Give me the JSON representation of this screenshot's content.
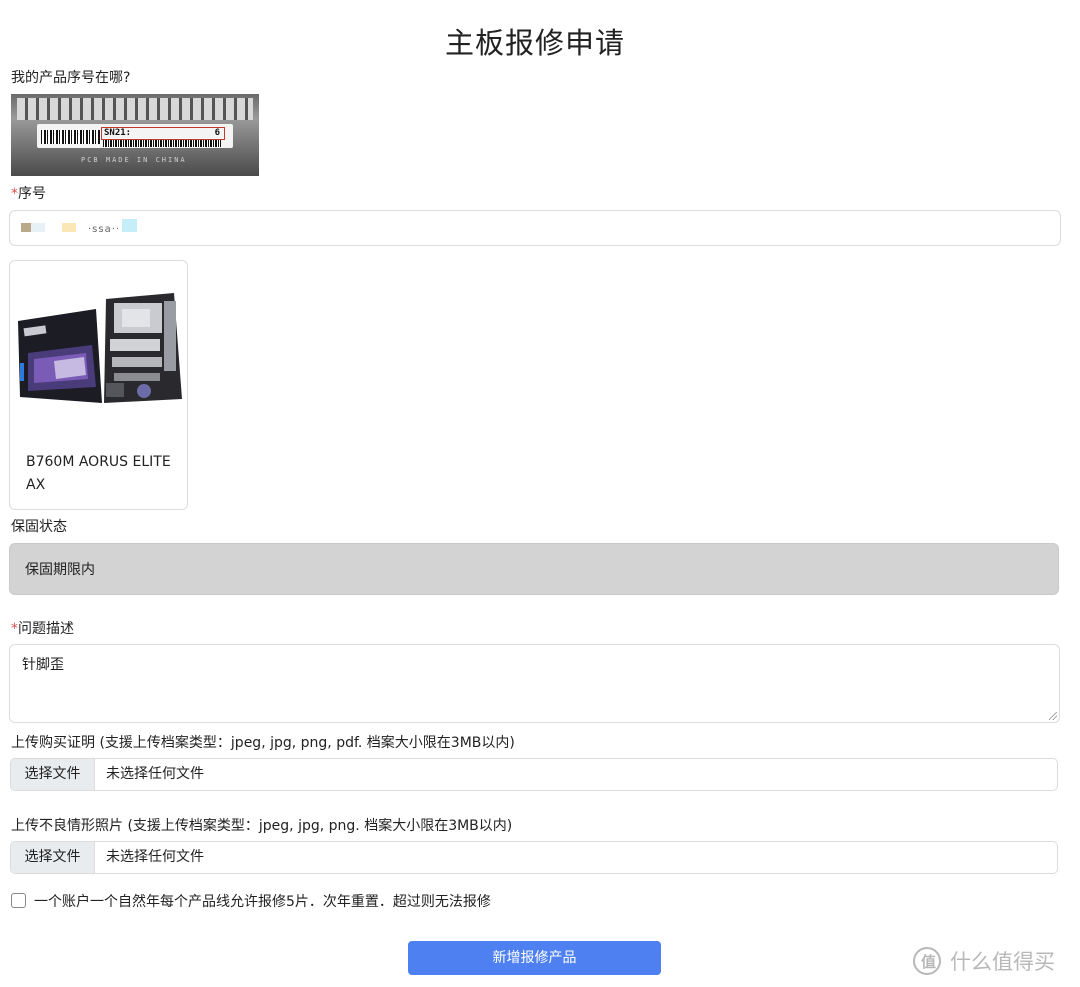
{
  "page": {
    "title": "主板报修申请"
  },
  "serial_help": {
    "label": "我的产品序号在哪?",
    "photo_text": "SN21:",
    "photo_digit": "6",
    "photo_pcb": "PCB MADE IN CHINA"
  },
  "serial": {
    "required_mark": "*",
    "label": "序号",
    "value_visible": "·ssa··"
  },
  "product": {
    "name": "B760M AORUS ELITE AX"
  },
  "warranty": {
    "label": "保固状态",
    "value": "保固期限内"
  },
  "problem": {
    "required_mark": "*",
    "label": "问题描述",
    "value": "针脚歪"
  },
  "proof_upload": {
    "label": "上传购买证明 (支援上传档案类型：jpeg, jpg, png, pdf. 档案大小限在3MB以内)",
    "button": "选择文件",
    "status": "未选择任何文件"
  },
  "defect_upload": {
    "label": "上传不良情形照片 (支援上传档案类型：jpeg, jpg, png. 档案大小限在3MB以内)",
    "button": "选择文件",
    "status": "未选择任何文件"
  },
  "agreement": {
    "text": "一个账户一个自然年每个产品线允许报修5片．次年重置．超过则无法报修",
    "checked": false
  },
  "submit": {
    "label": "新增报修产品",
    "color": "#4e80f2"
  },
  "watermark": {
    "logo_char": "值",
    "text": "什么值得买"
  }
}
